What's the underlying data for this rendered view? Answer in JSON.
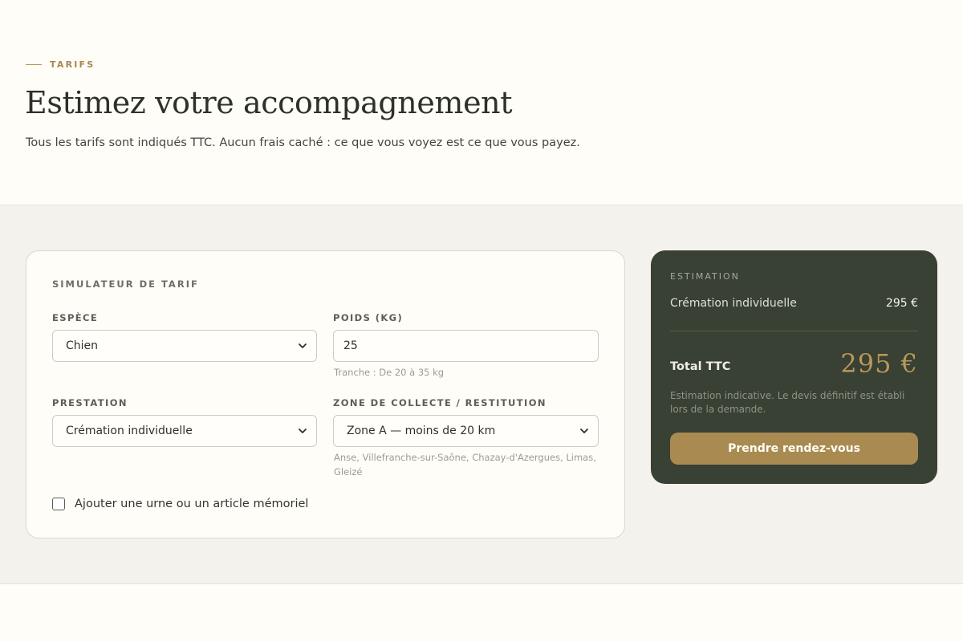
{
  "hero": {
    "eyebrow": "TARIFS",
    "title": "Estimez votre accompagnement",
    "subtitle": "Tous les tarifs sont indiqués TTC. Aucun frais caché : ce que vous voyez est ce que vous payez."
  },
  "simulator": {
    "title": "SIMULATEUR DE TARIF",
    "species": {
      "label": "ESPÈCE",
      "value": "Chien"
    },
    "weight": {
      "label": "POIDS (KG)",
      "value": "25",
      "help": "Tranche : De 20 à 35 kg"
    },
    "service": {
      "label": "PRESTATION",
      "value": "Crémation individuelle"
    },
    "zone": {
      "label": "ZONE DE COLLECTE / RESTITUTION",
      "value": "Zone A — moins de 20 km",
      "help": "Anse, Villefranche-sur-Saône, Chazay-d'Azergues, Limas, Gleizé"
    },
    "urn_checkbox": {
      "label": "Ajouter une urne ou un article mémoriel",
      "checked": false
    }
  },
  "estimate": {
    "title": "ESTIMATION",
    "line_label": "Crémation individuelle",
    "line_value": "295 €",
    "total_label": "Total TTC",
    "total_value": "295 €",
    "note": "Estimation indicative. Le devis définitif est établi lors de la demande.",
    "cta": "Prendre rendez-vous"
  },
  "colors": {
    "background": "#fefdf8",
    "band": "#f4f2ec",
    "accent": "#a98b52",
    "estimate_panel": "#394034"
  }
}
